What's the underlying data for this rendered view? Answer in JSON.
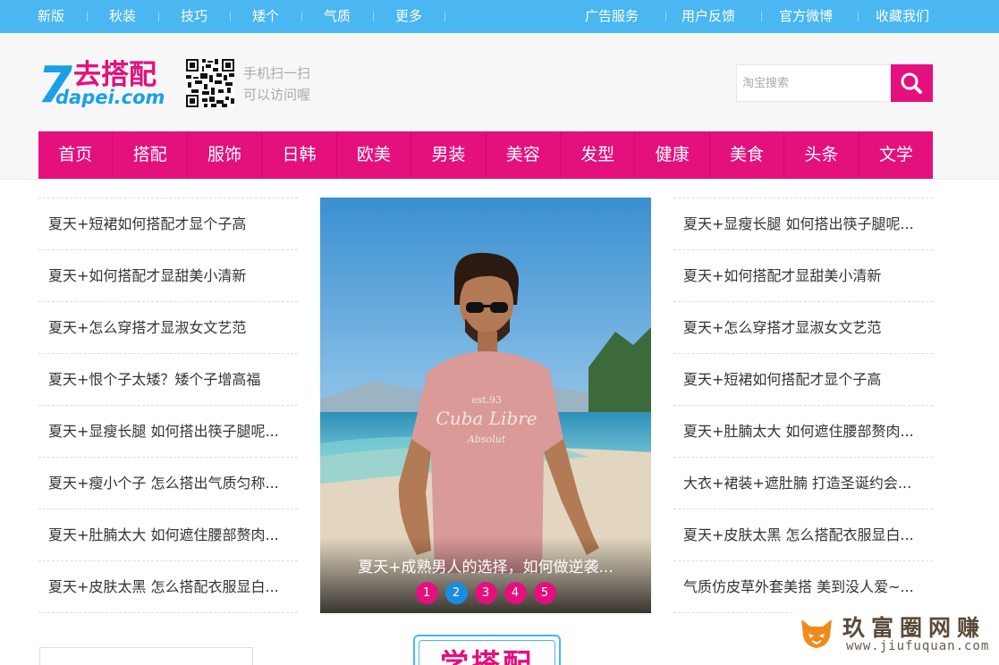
{
  "topbar": {
    "left_links": [
      "新版",
      "秋装",
      "技巧",
      "矮个",
      "气质",
      "更多"
    ],
    "right_links": [
      "广告服务",
      "用户反馈",
      "官方微博",
      "收藏我们"
    ]
  },
  "header": {
    "logo_brand": "去搭配",
    "logo_domain": "dapei.com",
    "logo_digit": "7",
    "qr_line1": "手机扫一扫",
    "qr_line2": "可以访问喔",
    "search_placeholder": "淘宝搜索"
  },
  "nav": [
    "首页",
    "搭配",
    "服饰",
    "日韩",
    "欧美",
    "男装",
    "美容",
    "发型",
    "健康",
    "美食",
    "头条",
    "文学"
  ],
  "left_list": [
    "夏天+短裙如何搭配才显个子高",
    "夏天+如何搭配才显甜美小清新",
    "夏天+怎么穿搭才显淑女文艺范",
    "夏天+恨个子太矮？矮个子增高福",
    "夏天+显瘦长腿 如何搭出筷子腿呢...",
    "夏天+瘦小个子 怎么搭出气质匀称...",
    "夏天+肚腩太大 如何遮住腰部赘肉...",
    "夏天+皮肤太黑 怎么搭配衣服显白..."
  ],
  "right_list": [
    "夏天+显瘦长腿 如何搭出筷子腿呢...",
    "夏天+如何搭配才显甜美小清新",
    "夏天+怎么穿搭才显淑女文艺范",
    "夏天+短裙如何搭配才显个子高",
    "夏天+肚腩太大 如何遮住腰部赘肉...",
    "大衣+裙装+遮肚腩 打造圣诞约会...",
    "夏天+皮肤太黑 怎么搭配衣服显白...",
    "气质仿皮草外套美搭 美到没人爱~..."
  ],
  "slider": {
    "caption": "夏天+成熟男人的选择，如何做逆袭...",
    "shirt_text_1": "est.93",
    "shirt_text_2": "Cuba Libre",
    "shirt_text_3": "Absolut",
    "dots": [
      "1",
      "2",
      "3",
      "4",
      "5"
    ],
    "active_dot": 2
  },
  "section": {
    "title": "学搭配"
  },
  "watermark": {
    "cn": "玖富圈网赚",
    "url": "www.jiufuquan.com"
  },
  "colors": {
    "topbar": "#4ab6f2",
    "accent": "#e4107d",
    "dot_active": "#1a8de0"
  }
}
